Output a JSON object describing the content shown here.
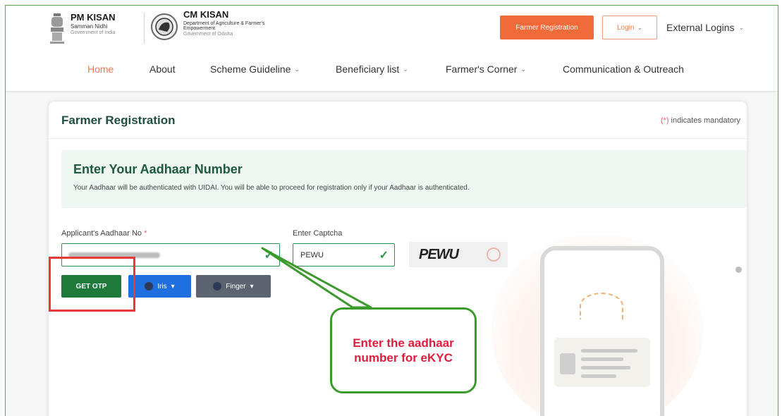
{
  "header": {
    "brand1": {
      "title": "PM KISAN",
      "line1": "Samman Nidhi",
      "line2": "Government of India"
    },
    "brand2": {
      "title": "CM KISAN",
      "line1": "Department of Agriculture & Farmer's Empowerment",
      "line2": "Government of Odisha"
    },
    "farmer_registration_button": "Farmer Registration",
    "login_button": "Login",
    "external_logins": "External Logins"
  },
  "nav": {
    "items": [
      {
        "label": "Home",
        "active": true
      },
      {
        "label": "About"
      },
      {
        "label": "Scheme Guideline",
        "dropdown": true
      },
      {
        "label": "Beneficiary list",
        "dropdown": true
      },
      {
        "label": "Farmer's Corner",
        "dropdown": true
      },
      {
        "label": "Communication & Outreach"
      }
    ]
  },
  "card": {
    "title": "Farmer Registration",
    "mandatory_star": "(*)",
    "mandatory_note": "indicates mandatory",
    "info_title": "Enter Your Aadhaar Number",
    "info_text": "Your Aadhaar will be authenticated with UIDAI. You will be able to proceed for registration only if your Aadhaar is authenticated.",
    "aadhaar_label": "Applicant's Aadhaar No",
    "required_star": "*",
    "captcha_label": "Enter Captcha",
    "captcha_value": "PEWU",
    "captcha_image_text": "PEWU",
    "get_otp_button": "GET OTP",
    "iris_button": "Iris",
    "finger_button": "Finger"
  },
  "annotation": {
    "callout_text": "Enter the aadhaar number for eKYC"
  },
  "colors": {
    "accent_orange": "#f06a3a",
    "primary_green": "#1e7a3b",
    "iris_blue": "#1f6fe0",
    "annotation_red": "#e53a3a",
    "callout_green": "#3b9a2c"
  }
}
